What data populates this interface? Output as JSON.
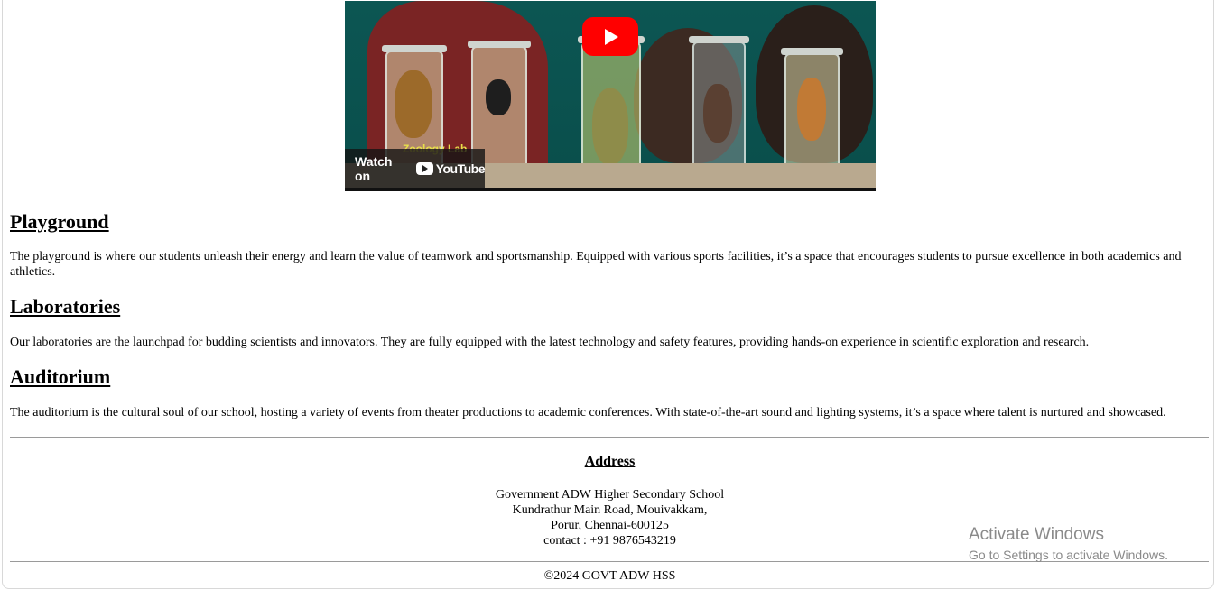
{
  "video": {
    "caption_text": "Zoology Lab",
    "watch_on_label": "Watch on",
    "youtube_label": "YouTube"
  },
  "sections": [
    {
      "heading": "Playground",
      "text": "The playground is where our students unleash their energy and learn the value of teamwork and sportsmanship. Equipped with various sports facilities, it’s a space that encourages students to pursue excellence in both academics and athletics."
    },
    {
      "heading": "Laboratories",
      "text": "Our laboratories are the launchpad for budding scientists and innovators. They are fully equipped with the latest technology and safety features, providing hands-on experience in scientific exploration and research."
    },
    {
      "heading": "Auditorium",
      "text": "The auditorium is the cultural soul of our school, hosting a variety of events from theater productions to academic conferences. With state-of-the-art sound and lighting systems, it’s a space where talent is nurtured and showcased."
    }
  ],
  "address": {
    "title": "Address",
    "line1": "Government ADW Higher Secondary School",
    "line2": "Kundrathur Main Road, Mouivakkam,",
    "line3": "Porur, Chennai-600125",
    "contact": "contact : +91 9876543219"
  },
  "footer": {
    "copyright": "©2024 GOVT ADW HSS"
  },
  "os_watermark": {
    "line1": "Activate Windows",
    "line2": "Go to Settings to activate Windows."
  },
  "colors": {
    "youtube_red": "#ff0000",
    "video_background": "#0f5b58",
    "divider": "#9a9a9a",
    "watermark": "#8a8a8a"
  }
}
